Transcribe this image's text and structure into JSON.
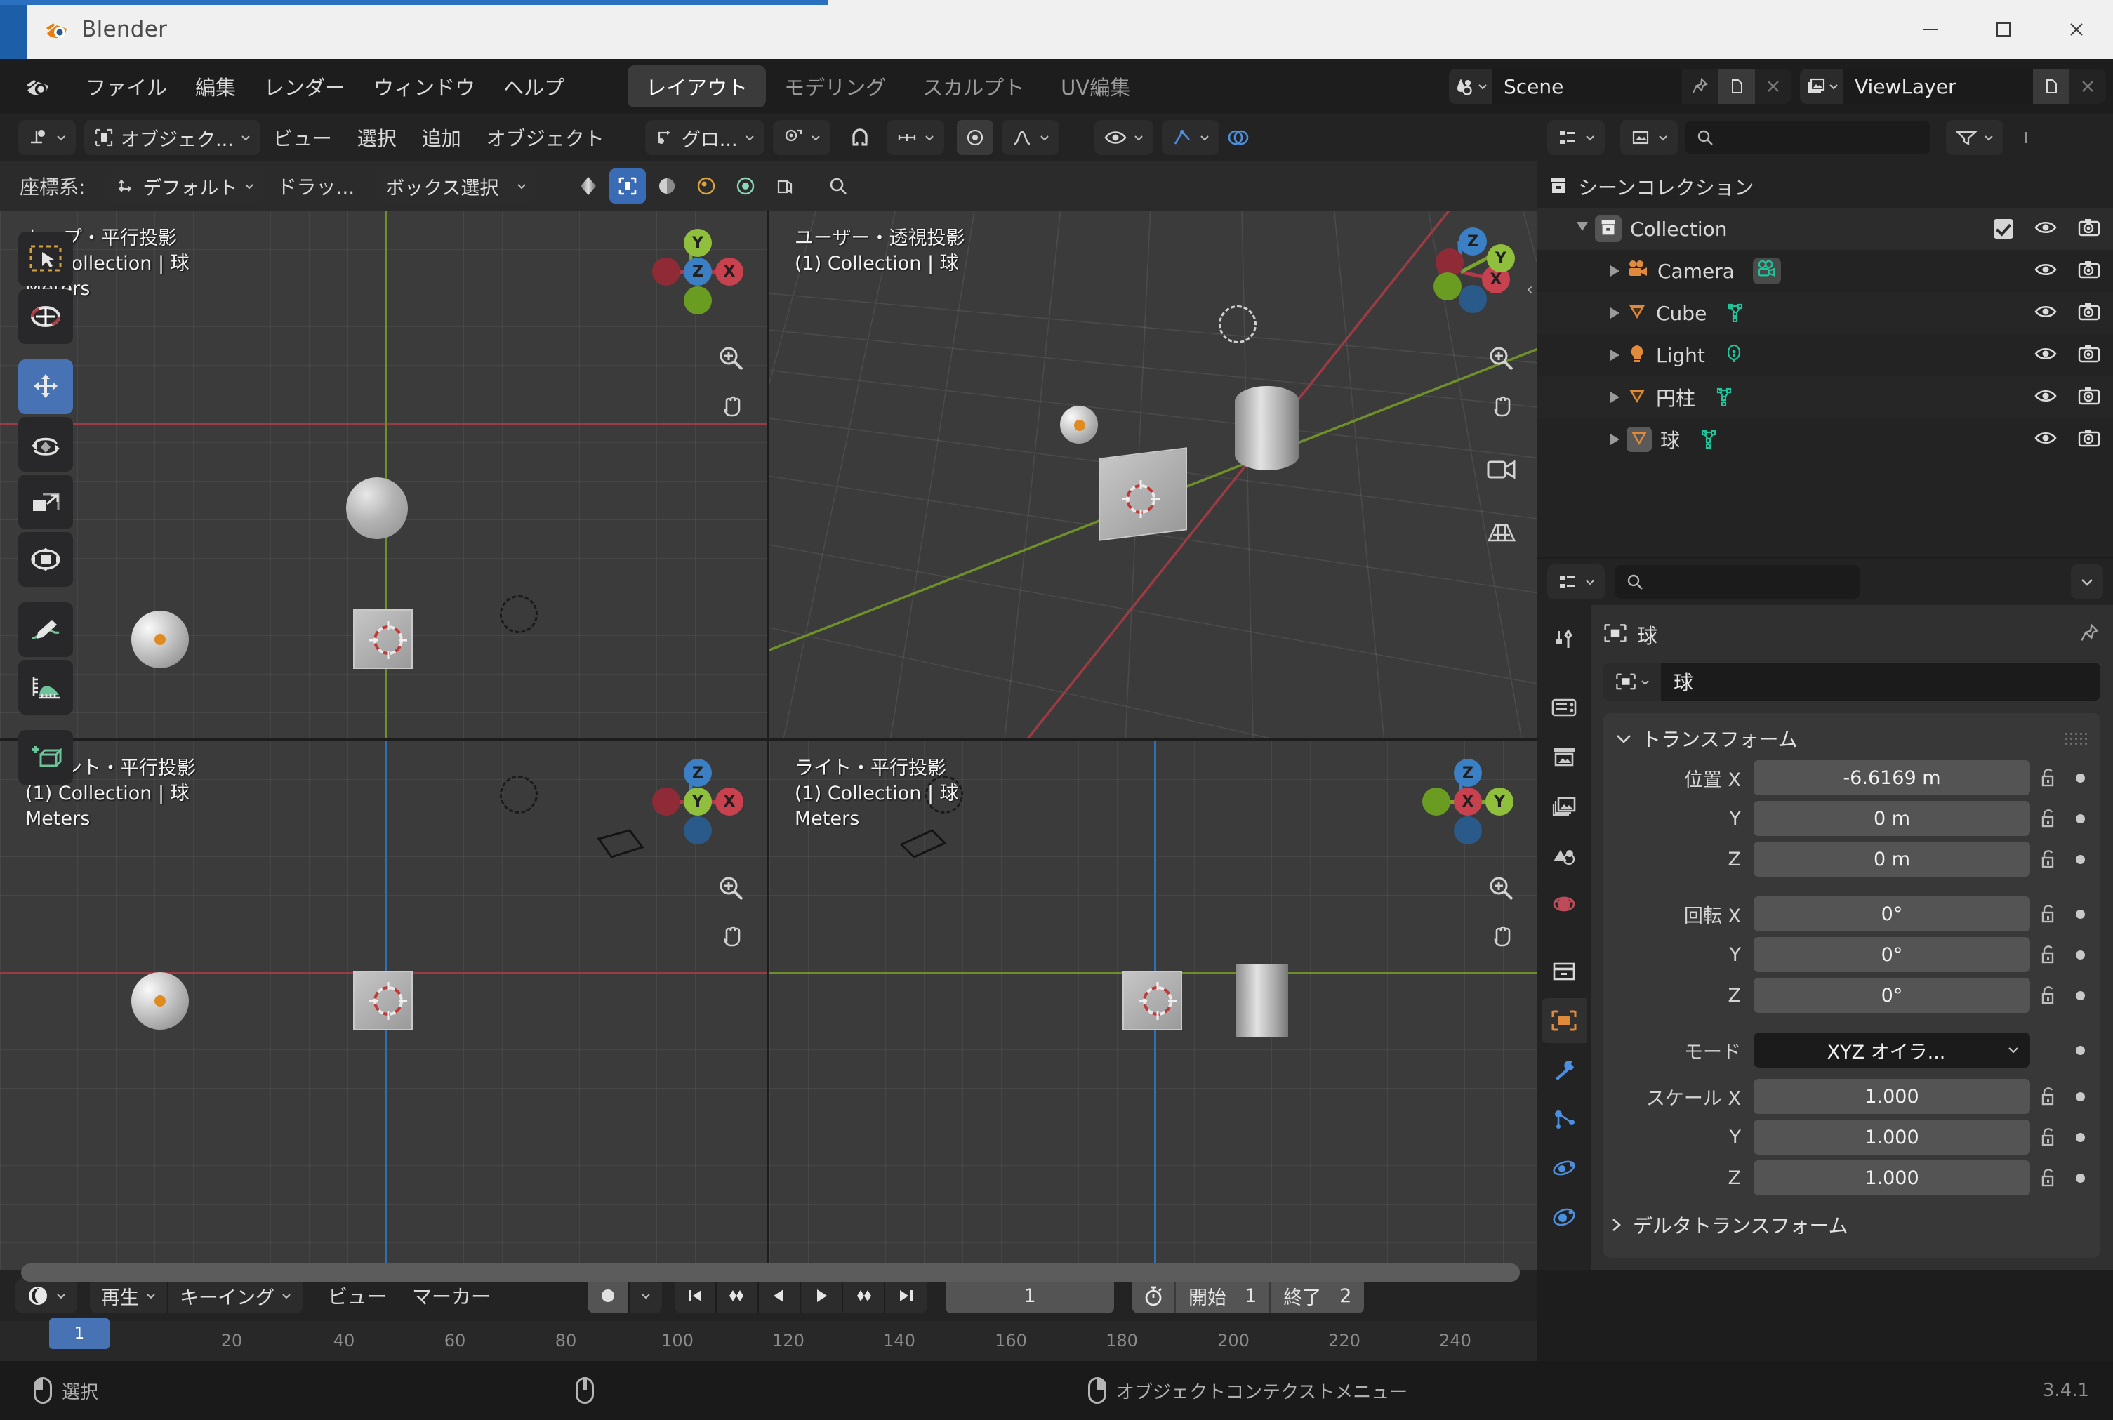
{
  "window": {
    "app_title": "Blender",
    "minimize": "minimize-icon",
    "maximize": "maximize-icon",
    "close": "close-icon"
  },
  "topbar": {
    "logo": "blender-logo-icon",
    "menus": [
      "ファイル",
      "編集",
      "レンダー",
      "ウィンドウ",
      "ヘルプ"
    ],
    "workspace_tabs": [
      {
        "label": "レイアウト",
        "active": true
      },
      {
        "label": "モデリング",
        "active": false
      },
      {
        "label": "スカルプト",
        "active": false
      },
      {
        "label": "UV編集",
        "active": false
      }
    ],
    "scene": {
      "icon": "scene-icon",
      "name": "Scene",
      "pin": "pin-icon",
      "new": "new-scene-icon",
      "remove": "x-icon"
    },
    "viewlayer": {
      "icon": "viewlayer-icon",
      "name": "ViewLayer",
      "new": "new-viewlayer-icon",
      "remove": "x-icon"
    }
  },
  "viewport_header": {
    "editor_type": "editor-type-icon",
    "mode": "オブジェク...",
    "mode_icon": "object-mode-icon",
    "menus": [
      "ビュー",
      "選択",
      "追加",
      "オブジェクト"
    ],
    "pivot": "グロ...",
    "pivot_icon": "transform-pivot-icon",
    "snap_icon": "magnet-icon",
    "snap_to": "snap-to-icon",
    "proportional_icon": "proportional-edit-icon",
    "proportional_falloff": "falloff-icon",
    "visibility_icon": "eye-icon",
    "gizmo_icon": "gizmo-icon",
    "overlays_icon": "overlays-icon"
  },
  "viewport_subheader": {
    "orientation_label": "座標系:",
    "orientation_value": "デフォルト",
    "orientation_icon": "orientation-icon",
    "drag_label": "ドラッ...",
    "drag_value": "ボックス選択",
    "shading_modes": [
      "wireframe-icon",
      "solid-icon",
      "material-preview-icon",
      "rendered-icon"
    ],
    "xray_icon": "xray-icon",
    "search_icon": "search-icon"
  },
  "outliner": {
    "root": {
      "label": "シーンコレクション",
      "icon": "scene-collection-icon"
    },
    "rows": [
      {
        "label": "Collection",
        "icon": "collection-icon",
        "indent": 1,
        "expanded": true,
        "checkbox": true,
        "eye": true,
        "camera": true,
        "selected": true
      },
      {
        "label": "Camera",
        "icon": "camera-object-icon",
        "indent": 2,
        "expanded": false,
        "data_icon": "camera-data-icon",
        "eye": true,
        "camera": true,
        "selected": false
      },
      {
        "label": "Cube",
        "icon": "mesh-object-icon",
        "indent": 2,
        "expanded": false,
        "data_icon": "mesh-data-icon",
        "eye": true,
        "camera": true,
        "selected": false
      },
      {
        "label": "Light",
        "icon": "light-object-icon",
        "indent": 2,
        "expanded": false,
        "data_icon": "light-data-icon",
        "eye": true,
        "camera": true,
        "selected": false
      },
      {
        "label": "円柱",
        "icon": "mesh-object-icon",
        "indent": 2,
        "expanded": false,
        "data_icon": "mesh-data-icon",
        "eye": true,
        "camera": true,
        "selected": false
      },
      {
        "label": "球",
        "icon": "mesh-object-icon",
        "indent": 2,
        "expanded": false,
        "data_icon": "mesh-data-icon",
        "eye": true,
        "camera": true,
        "selected": true
      }
    ],
    "filter_icon": "filter-icon",
    "display_mode_icon": "display-mode-icon",
    "search_placeholder": ""
  },
  "viewports": [
    {
      "id": "top",
      "title": "トップ・平行投影",
      "subtitle": "(1) Collection | 球",
      "units": "Meters"
    },
    {
      "id": "user",
      "title": "ユーザー・透視投影",
      "subtitle": "(1) Collection | 球",
      "units": ""
    },
    {
      "id": "front",
      "title": "フロント・平行投影",
      "subtitle": "(1) Collection | 球",
      "units": "Meters"
    },
    {
      "id": "right",
      "title": "ライト・平行投影",
      "subtitle": "(1) Collection | 球",
      "units": "Meters"
    }
  ],
  "toolbar": {
    "tools": [
      {
        "name": "tweak-tool",
        "selected": false
      },
      {
        "name": "cursor-tool",
        "selected": false
      },
      {
        "name": "move-tool",
        "selected": true
      },
      {
        "name": "rotate-tool",
        "selected": false
      },
      {
        "name": "scale-tool",
        "selected": false
      },
      {
        "name": "transform-tool",
        "selected": false
      },
      {
        "name": "annotate-tool",
        "selected": false
      },
      {
        "name": "measure-tool",
        "selected": false
      },
      {
        "name": "add-cube-tool",
        "selected": false
      }
    ]
  },
  "properties": {
    "editor_icon": "properties-editor-icon",
    "search_placeholder": "",
    "breadcrumb_object": "球",
    "breadcrumb_icon": "object-icon",
    "pin_icon": "pin-icon",
    "object_name": "球",
    "tabs": [
      {
        "name": "tool-tab",
        "active": false
      },
      {
        "name": "render-tab",
        "active": false
      },
      {
        "name": "output-tab",
        "active": false
      },
      {
        "name": "view-layer-tab",
        "active": false
      },
      {
        "name": "scene-tab",
        "active": false
      },
      {
        "name": "world-tab",
        "active": false
      },
      {
        "name": "collection-tab",
        "active": false
      },
      {
        "name": "object-tab",
        "active": true
      },
      {
        "name": "modifier-tab",
        "active": false
      },
      {
        "name": "particles-tab",
        "active": false
      },
      {
        "name": "physics-tab",
        "active": false
      },
      {
        "name": "constraints-tab",
        "active": false
      }
    ],
    "transform_panel": {
      "title": "トランスフォーム",
      "location_label": "位置",
      "rotation_label": "回転",
      "scale_label": "スケール",
      "mode_label": "モード",
      "mode_value": "XYZ オイラ...",
      "axes": [
        "X",
        "Y",
        "Z"
      ],
      "location": [
        "-6.6169 m",
        "0 m",
        "0 m"
      ],
      "rotation": [
        "0°",
        "0°",
        "0°"
      ],
      "scale": [
        "1.000",
        "1.000",
        "1.000"
      ]
    },
    "delta_transform_label": "デルタトランスフォーム"
  },
  "timeline": {
    "editor_icon": "timeline-editor-icon",
    "menus_grouped": [
      "再生",
      "キーイング"
    ],
    "menus_plain": [
      "ビュー",
      "マーカー"
    ],
    "autokey_icon": "record-icon",
    "playback_buttons": [
      "jump-to-start-icon",
      "prev-keyframe-icon",
      "play-reverse-icon",
      "play-icon",
      "next-keyframe-icon",
      "jump-to-end-icon"
    ],
    "current_frame": "1",
    "timer_icon": "stopwatch-icon",
    "start_label": "開始",
    "start_value": "1",
    "end_label": "終了",
    "end_value": "2",
    "ruler_ticks": [
      "20",
      "40",
      "60",
      "80",
      "100",
      "120",
      "140",
      "160",
      "180",
      "200",
      "220",
      "240"
    ],
    "playhead_label": "1"
  },
  "statusbar": {
    "left_mouse": "左クリック",
    "left_action": "選択",
    "middle_action": "",
    "right_action": "オブジェクトコンテクストメニュー",
    "version": "3.4.1"
  }
}
